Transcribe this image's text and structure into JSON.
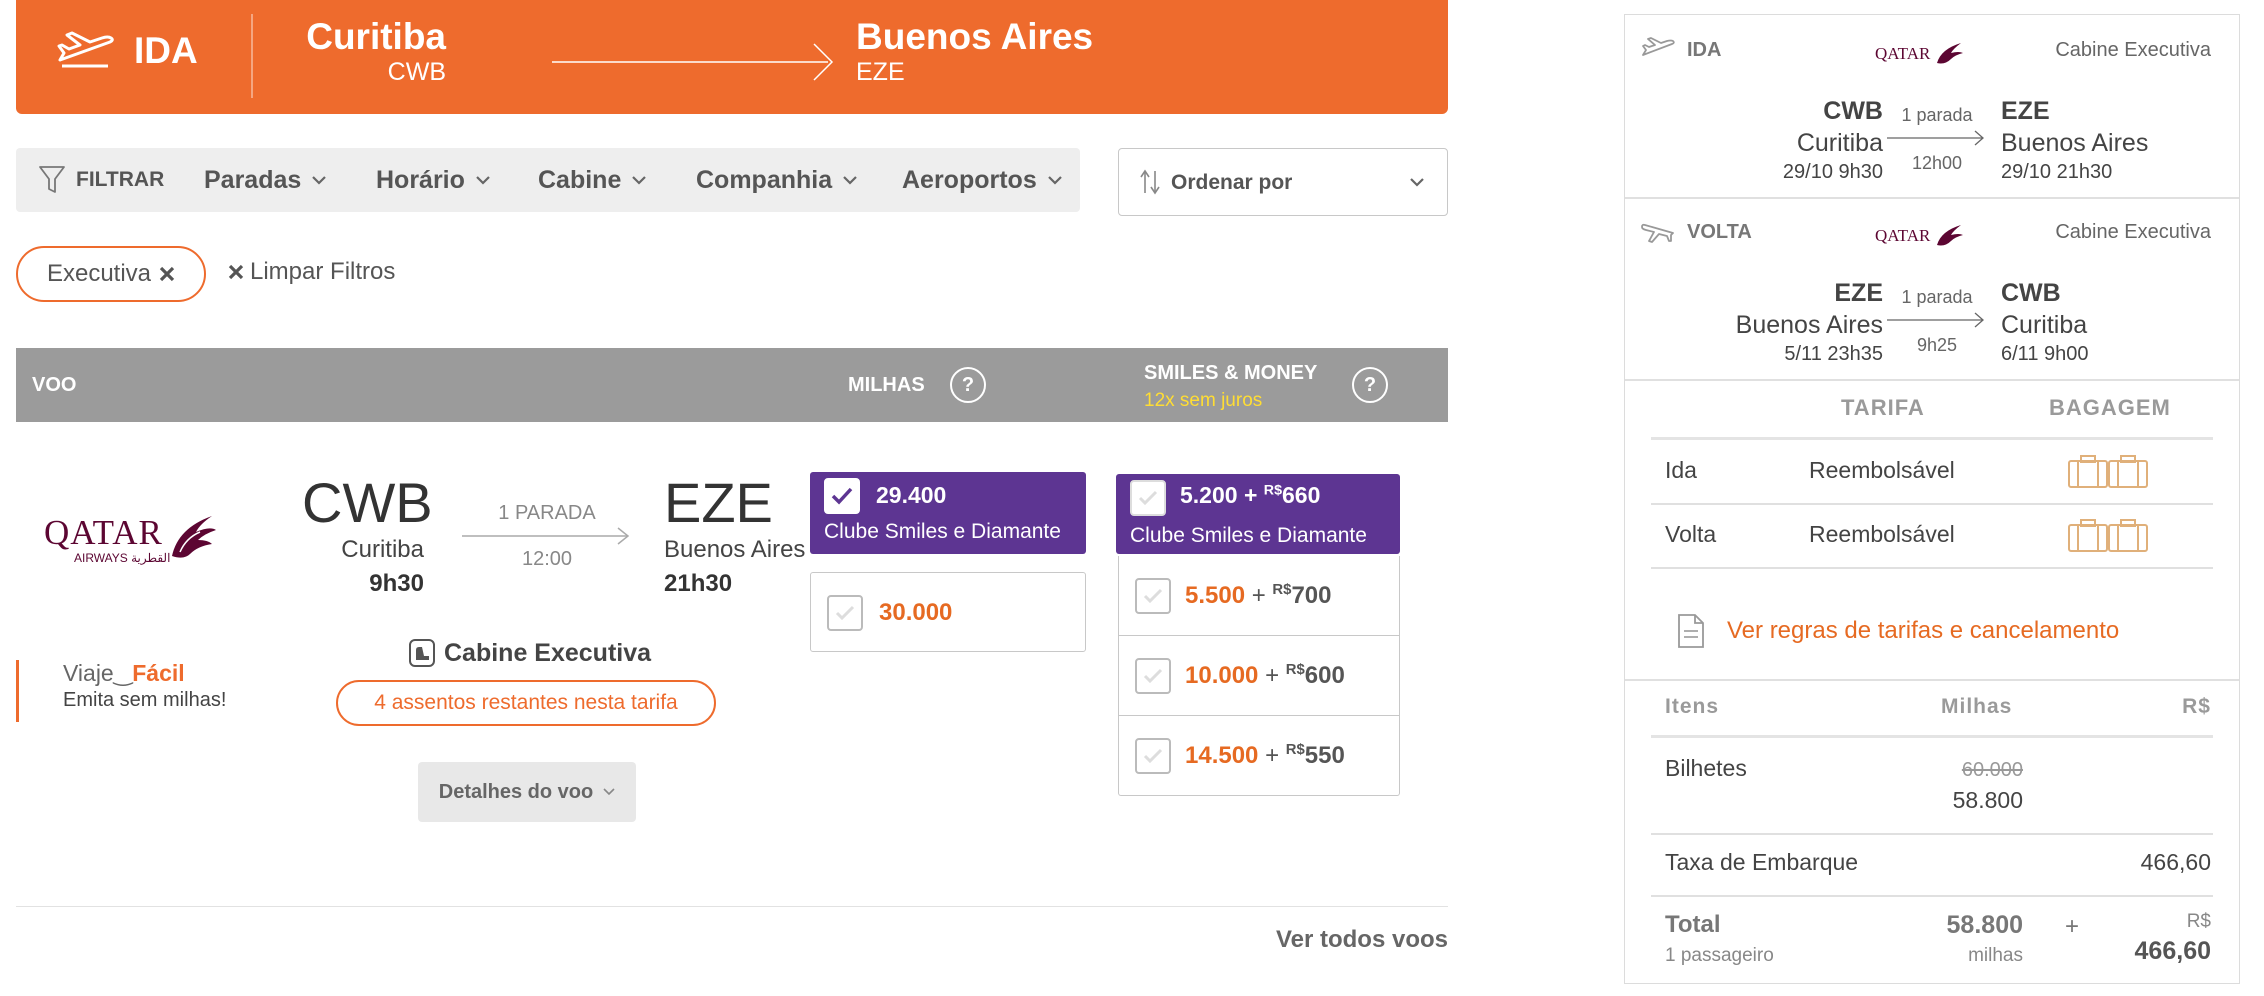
{
  "banner": {
    "direction": "IDA",
    "origin_city": "Curitiba",
    "origin_code": "CWB",
    "destination_city": "Buenos Aires",
    "destination_code": "EZE"
  },
  "filters": {
    "filter_label": "FILTRAR",
    "items": [
      "Paradas",
      "Horário",
      "Cabine",
      "Companhia",
      "Aeroportos"
    ],
    "sort_label": "Ordenar por"
  },
  "active_filters": {
    "chip": "Executiva",
    "clear_label": "Limpar Filtros"
  },
  "table_header": {
    "flight": "VOO",
    "miles": "MILHAS",
    "smiles_money": "SMILES & MONEY",
    "installments": "12x sem juros",
    "help": "?"
  },
  "flight": {
    "airline": "QATAR",
    "airline_sub": "AIRWAYS القطرية",
    "origin_code": "CWB",
    "origin_city": "Curitiba",
    "departure": "9h30",
    "stops": "1 PARADA",
    "duration": "12:00",
    "destination_code": "EZE",
    "destination_city": "Buenos Aires",
    "arrival": "21h30",
    "cabin": "Cabine Executiva",
    "seats_left": "4 assentos restantes nesta tarifa",
    "details_button": "Detalhes do voo",
    "viaje_facil_1": "Viaje",
    "viaje_facil_2": "Fácil",
    "viaje_facil_sub": "Emita sem milhas!"
  },
  "miles_options": [
    {
      "value": "29.400",
      "label": "Clube Smiles e Diamante",
      "selected": true
    },
    {
      "value": "30.000",
      "selected": false
    }
  ],
  "smiles_money_options": [
    {
      "miles": "5.200",
      "plus": "+",
      "currency": "R$",
      "money": "660",
      "label": "Clube Smiles e Diamante",
      "selected": true
    },
    {
      "miles": "5.500",
      "plus": "+",
      "currency": "R$",
      "money": "700",
      "selected": false
    },
    {
      "miles": "10.000",
      "plus": "+",
      "currency": "R$",
      "money": "600",
      "selected": false
    },
    {
      "miles": "14.500",
      "plus": "+",
      "currency": "R$",
      "money": "550",
      "selected": false
    }
  ],
  "see_all": "Ver todos voos",
  "summary": {
    "outbound": {
      "direction": "IDA",
      "airline": "QATAR",
      "cabin": "Cabine Executiva",
      "from_code": "CWB",
      "from_city": "Curitiba",
      "from_date": "29/10 9h30",
      "stops": "1 parada",
      "duration": "12h00",
      "to_code": "EZE",
      "to_city": "Buenos Aires",
      "to_date": "29/10 21h30"
    },
    "inbound": {
      "direction": "VOLTA",
      "airline": "QATAR",
      "cabin": "Cabine Executiva",
      "from_code": "EZE",
      "from_city": "Buenos Aires",
      "from_date": "5/11 23h35",
      "stops": "1 parada",
      "duration": "9h25",
      "to_code": "CWB",
      "to_city": "Curitiba",
      "to_date": "6/11 9h00"
    },
    "fare_table": {
      "col_fare": "TARIFA",
      "col_bag": "BAGAGEM",
      "rows": [
        {
          "leg": "Ida",
          "fare": "Reembolsável"
        },
        {
          "leg": "Volta",
          "fare": "Reembolsável"
        }
      ]
    },
    "rules_link": "Ver regras de tarifas e cancelamento",
    "price": {
      "col_items": "Itens",
      "col_miles": "Milhas",
      "col_money": "R$",
      "tickets_label": "Bilhetes",
      "tickets_old": "60.000",
      "tickets_new": "58.800",
      "tax_label": "Taxa de Embarque",
      "tax_value": "466,60",
      "total_label": "Total",
      "passengers": "1 passageiro",
      "total_miles": "58.800",
      "miles_unit": "milhas",
      "plus": "+",
      "currency": "R$",
      "total_money": "466,60"
    }
  },
  "colors": {
    "brand_orange": "#ee6b2d",
    "purple": "#5d3592",
    "header_gray": "#9b9b9b",
    "highlight_yellow": "#ffdd33"
  }
}
